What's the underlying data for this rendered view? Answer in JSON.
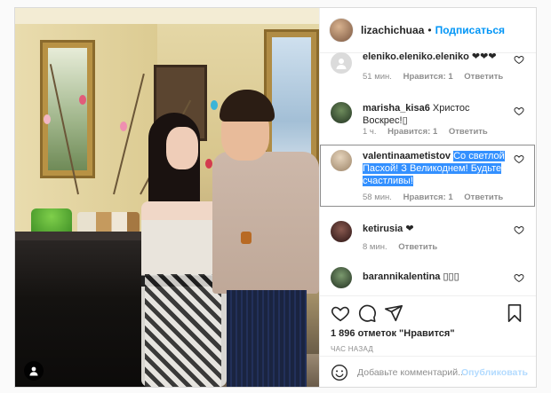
{
  "post": {
    "author": "lizachichuaa",
    "separator": "•",
    "follow_label": "Подписаться"
  },
  "comments": [
    {
      "username": "eleniko.eleniko.eleniko",
      "text": "❤❤❤",
      "time": "51 мин.",
      "likes": "Нравится: 1",
      "reply": "Ответить",
      "avatar_color": "#dbdbdb"
    },
    {
      "username": "marisha_kisa6",
      "text": "Христос Воскрес!",
      "text_tail": "▯",
      "time": "1 ч.",
      "likes": "Нравится: 1",
      "reply": "Ответить",
      "avatar_color": "#3b5a3a"
    },
    {
      "username": "valentinaametistov",
      "text": "Со светлой Пасхой! З Великоднем! Будьте счастливы!",
      "time": "58 мин.",
      "likes": "Нравится: 1",
      "reply": "Ответить",
      "avatar_color": "#c9b59a"
    },
    {
      "username": "ketirusia",
      "text": "❤",
      "time": "8 мин.",
      "reply": "Ответить",
      "avatar_color": "#4a2a2a"
    },
    {
      "username": "barannikalentina",
      "text": "▯▯▯",
      "avatar_color": "#3d4a3a"
    }
  ],
  "actions": {
    "likes_count": "1 896 отметок \"Нравится\"",
    "time_ago": "ЧАС НАЗАД"
  },
  "add_comment": {
    "placeholder": "Добавьте комментарий...",
    "publish_label": "Опубликовать"
  },
  "colors": {
    "accent": "#0095f6",
    "selection": "#3390ff",
    "muted": "#8e8e8e"
  },
  "icons": [
    "heart-icon",
    "comment-icon",
    "share-icon",
    "bookmark-icon",
    "smile-icon",
    "user-tag-icon"
  ]
}
